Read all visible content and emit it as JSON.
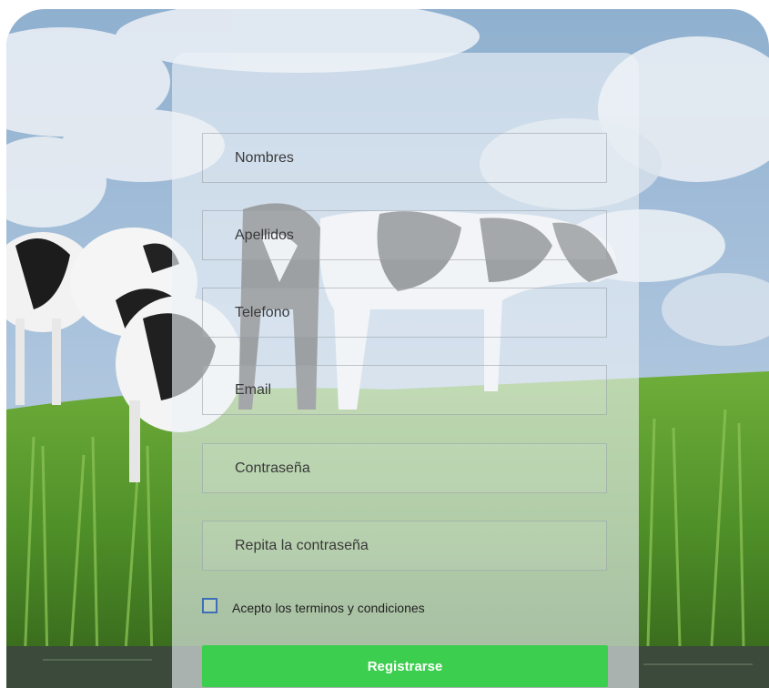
{
  "form": {
    "fields": [
      {
        "placeholder": "Nombres"
      },
      {
        "placeholder": "Apellidos"
      },
      {
        "placeholder": "Telefono"
      },
      {
        "placeholder": "Email"
      },
      {
        "placeholder": "Contraseña"
      },
      {
        "placeholder": "Repita la contraseña"
      }
    ],
    "terms_label": "Acepto los terminos y condiciones",
    "terms_checked": false,
    "submit_label": "Registrarse"
  },
  "colors": {
    "submit_button": "#3cce4e",
    "checkbox_border": "#3d6fb6"
  },
  "background": {
    "subject": "holstein-cows-on-grassy-riverbank"
  }
}
